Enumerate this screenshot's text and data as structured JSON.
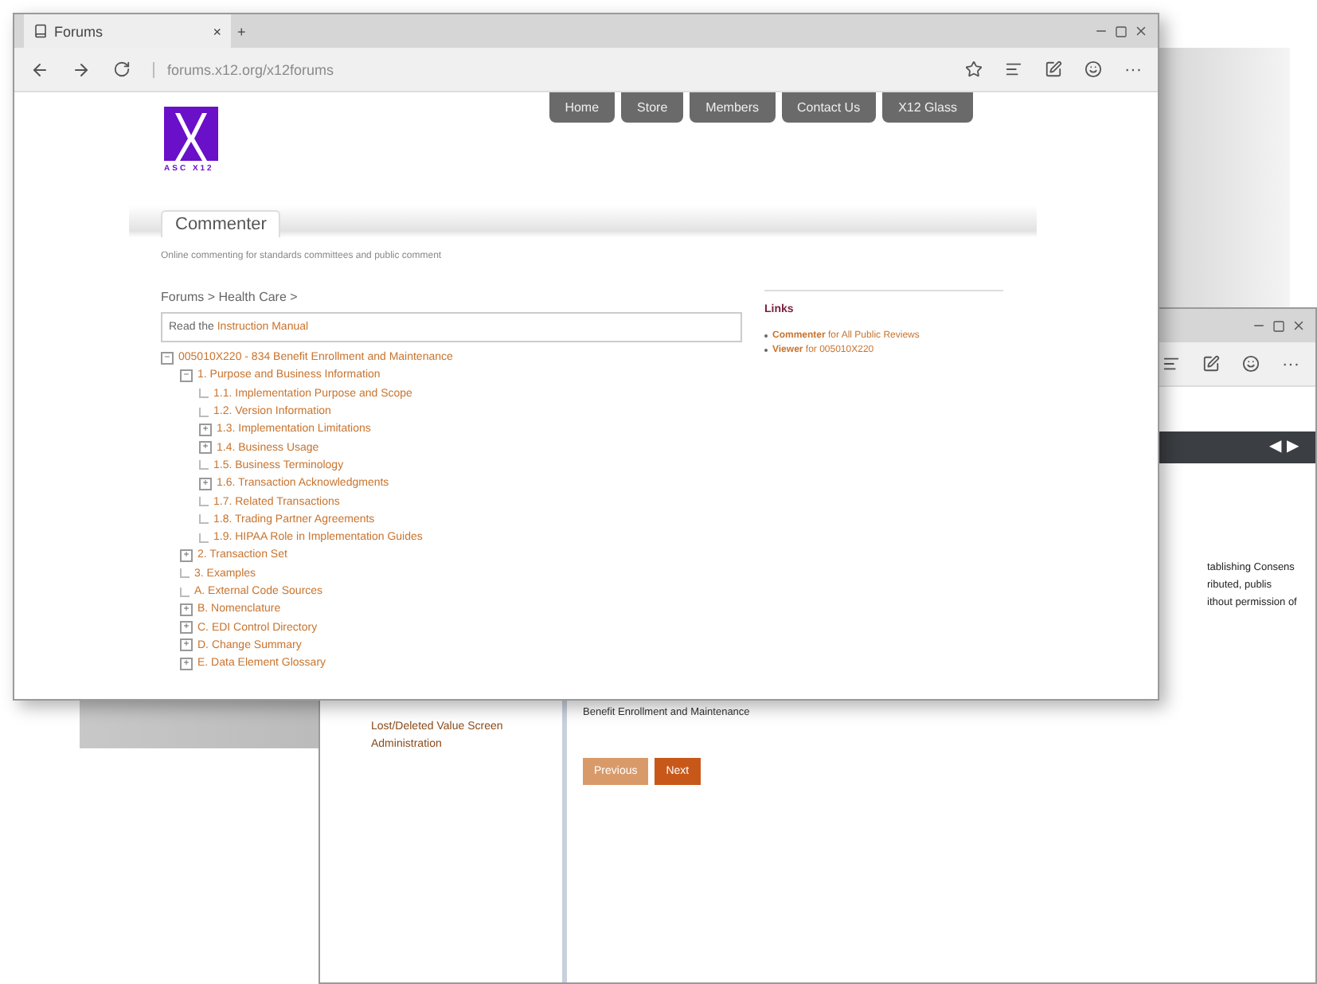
{
  "back_window": {
    "toolbar_more": "···",
    "pager": {
      "previous": "◀",
      "next": "▶"
    },
    "body_fragments": [
      "tablishing Consens",
      "ributed, publis",
      "ithout permission of"
    ],
    "sidebar_items": [
      "Lost/Deleted Value Screen",
      "Administration"
    ],
    "heading": "Benefit Enrollment and Maintenance",
    "buttons": [
      {
        "label": "Previous",
        "kind": "secondary"
      },
      {
        "label": "Next",
        "kind": "primary"
      }
    ]
  },
  "front_window": {
    "tab": {
      "title": "Forums",
      "close": "×",
      "new": "+"
    },
    "address": "forums.x12.org/x12forums",
    "toolbar_more": "···",
    "nav": [
      "Home",
      "Store",
      "Members",
      "Contact Us",
      "X12 Glass"
    ],
    "logo": {
      "caption": "ASC X12"
    },
    "toggle_glyphs": {
      "expanded": "−",
      "collapsed": "+"
    },
    "page_tab": "Commenter",
    "subtitle": "Online commenting for standards committees and public comment",
    "breadcrumb": "Forums > Health Care >",
    "notice": {
      "text": "Read the ",
      "link": "Instruction Manual"
    },
    "tree": [
      {
        "label": "005010X220 - 834 Benefit Enrollment and Maintenance",
        "expanded": true,
        "children": [
          {
            "label": "1. Purpose and Business Information",
            "expanded": true,
            "children": [
              {
                "label": "1.1. Implementation Purpose and Scope"
              },
              {
                "label": "1.2. Version Information"
              },
              {
                "label": "1.3. Implementation Limitations",
                "expanded": false
              },
              {
                "label": "1.4. Business Usage",
                "expanded": false
              },
              {
                "label": "1.5. Business Terminology"
              },
              {
                "label": "1.6. Transaction Acknowledgments",
                "expanded": false
              },
              {
                "label": "1.7. Related Transactions"
              },
              {
                "label": "1.8. Trading Partner Agreements"
              },
              {
                "label": "1.9. HIPAA Role in Implementation Guides"
              }
            ]
          },
          {
            "label": "2. Transaction Set",
            "expanded": false
          },
          {
            "label": "3. Examples"
          },
          {
            "label": "A. External Code Sources"
          },
          {
            "label": "B. Nomenclature",
            "expanded": false
          },
          {
            "label": "C. EDI Control Directory",
            "expanded": false
          },
          {
            "label": "D. Change Summary",
            "expanded": false
          },
          {
            "label": "E. Data Element Glossary",
            "expanded": false
          }
        ]
      }
    ],
    "links": {
      "title": "Links",
      "items": [
        {
          "strong": "Commenter",
          "rest": " for All Public Reviews"
        },
        {
          "strong": "Viewer",
          "rest": " for 005010X220"
        }
      ]
    }
  }
}
